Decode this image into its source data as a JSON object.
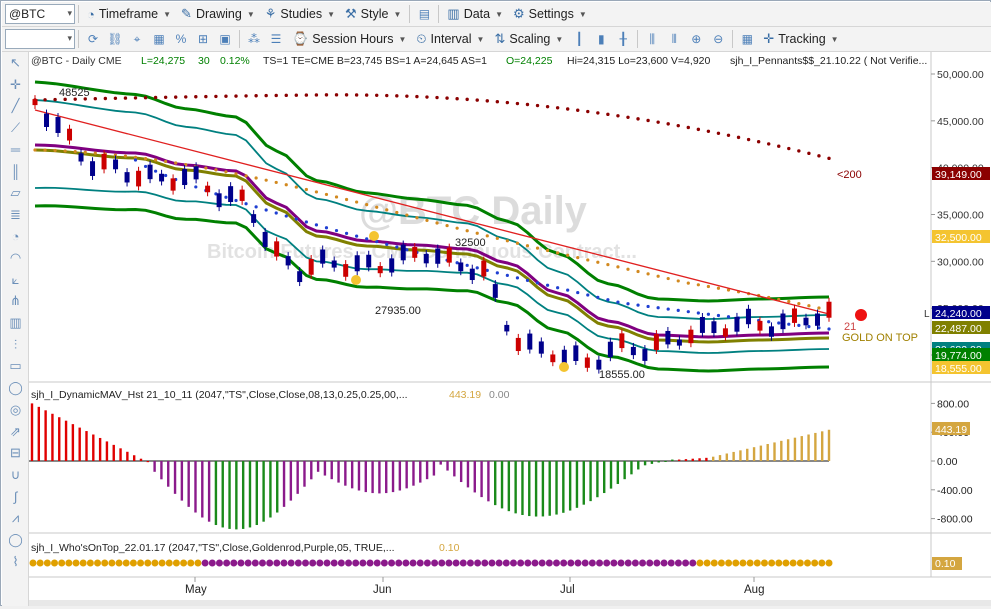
{
  "toolbar1": {
    "symbol": "@BTC",
    "timeframe": "Timeframe",
    "drawing": "Drawing",
    "studies": "Studies",
    "style": "Style",
    "data": "Data",
    "settings": "Settings"
  },
  "toolbar2": {
    "session_hours": "Session Hours",
    "interval": "Interval",
    "scaling": "Scaling",
    "tracking": "Tracking"
  },
  "price_header": {
    "symbol_info": "@BTC - Daily  CME",
    "last": "L=24,275",
    "change": "30",
    "pct": "0.12%",
    "rest": "TS=1  TE=CME  B=23,745  BS=1  A=24,645  AS=1",
    "open": "O=24,225",
    "hilo": "Hi=24,315  Lo=23,600  V=4,920",
    "study": "sjh_I_Pennants$$_21.10.22 ( Not Verifie..."
  },
  "watermark": {
    "title": "@BTC Daily",
    "subtitle": "Bitcoin Futures - CME Continuous Contract..."
  },
  "annotations": {
    "high": "48525",
    "mid_high": "32500",
    "low1": "27935.00",
    "low2": "18555.00",
    "ma200": "<200",
    "ma21": "21",
    "gold": "GOLD ON TOP",
    "l_marker": "L"
  },
  "price_axis": {
    "ticks": [
      "50,000.00",
      "45,000.00",
      "40,000.00",
      "35,000.00",
      "30,000.00",
      "25,000.00",
      "20,000.00"
    ],
    "tags": [
      {
        "label": "39,149.00",
        "color": "#8b0000",
        "text_color": "#ffffff"
      },
      {
        "label": "32,500.00",
        "color": "#f4c430",
        "text_color": "#ffffff"
      },
      {
        "label": "24,240.00",
        "color": "#00008b",
        "text_color": "#ffffff"
      },
      {
        "label": "22,487.00",
        "color": "#808000",
        "text_color": "#ffffff"
      },
      {
        "label": "20,682.00",
        "color": "#008080",
        "text_color": "#ffffff"
      },
      {
        "label": "19,774.00",
        "color": "#008000",
        "text_color": "#ffffff"
      },
      {
        "label": "18,555.00",
        "color": "#f4c430",
        "text_color": "#ffffff"
      }
    ]
  },
  "macd_panel": {
    "title": "sjh_I_DynamicMAV_Hst 21_10_11 (2047,\"TS\",Close,Close,08,13,0.25,0.25,00,...",
    "value1": "443.19",
    "value2": "0.00",
    "ticks": [
      "800.00",
      "400.00",
      "0.00",
      "-400.00",
      "-800.00"
    ],
    "tag": "443.19"
  },
  "who_panel": {
    "title": "sjh_I_Who'sOnTop_22.01.17 (2047,\"TS\",Close,Goldenrod,Purple,05, TRUE,...",
    "value": "0.10",
    "tag": "0.10"
  },
  "time_axis": [
    "May",
    "Jun",
    "Jul",
    "Aug"
  ],
  "colors": {
    "up_bar": "#00008b",
    "down_bar": "#cc0000",
    "bb_outer": "#008000",
    "bb_inner": "#008080",
    "ma_gold": "#808000",
    "ma_purple": "#800080",
    "ma200": "#8b0000",
    "dots_orange": "#d2891f",
    "dots_blue": "#1f3fd2",
    "trend": "#e02020",
    "hist_red": "#e00000",
    "hist_purple": "#8b1a8b",
    "hist_green": "#1a8a1a",
    "hist_gold": "#d4a640"
  },
  "chart_data": {
    "type": "candlestick",
    "title": "@BTC Daily",
    "y_range": [
      16000,
      52000
    ],
    "series": [
      {
        "name": "price_close_approx",
        "values": [
          47000,
          44000,
          40500,
          40000,
          39000,
          38800,
          39000,
          37000,
          36500,
          31000,
          29000,
          30000,
          29500,
          29500,
          30500,
          31000,
          29500,
          29000,
          22000,
          20500,
          20000,
          19000,
          21000,
          20500,
          21500,
          22500,
          23000,
          23500,
          23000,
          24000,
          24275
        ]
      }
    ],
    "histogram": {
      "name": "DynamicMAV",
      "last": 443.19
    },
    "who_on_top": {
      "last": 0.1
    }
  }
}
